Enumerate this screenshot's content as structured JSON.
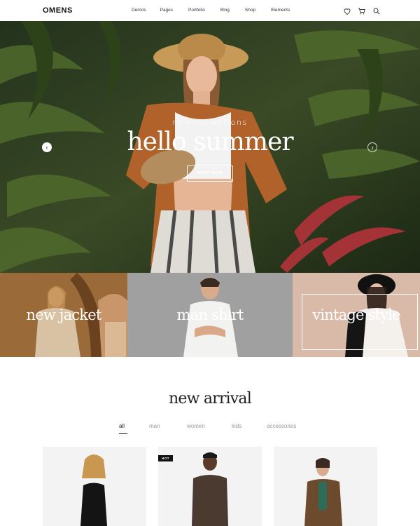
{
  "header": {
    "logo": "OMENS",
    "nav": [
      "Demos",
      "Pages",
      "Portfolio",
      "Blog",
      "Shop",
      "Elements"
    ],
    "icons": [
      "heart-icon",
      "cart-icon",
      "search-icon"
    ]
  },
  "hero": {
    "subtitle": "new collections",
    "title": "hello summer",
    "button_label": "SHOP NOW"
  },
  "categories": [
    {
      "label": "new jacket"
    },
    {
      "label": "man shirt"
    },
    {
      "label": "vintage style"
    }
  ],
  "new_arrival": {
    "title": "new arrival",
    "filters": [
      "all",
      "man",
      "women",
      "kids",
      "accessories"
    ],
    "active_filter": "all",
    "products": [
      {
        "badge": ""
      },
      {
        "badge": "HOT"
      },
      {
        "badge": ""
      }
    ]
  },
  "colors": {
    "accent": "#111111",
    "muted": "#999999"
  }
}
